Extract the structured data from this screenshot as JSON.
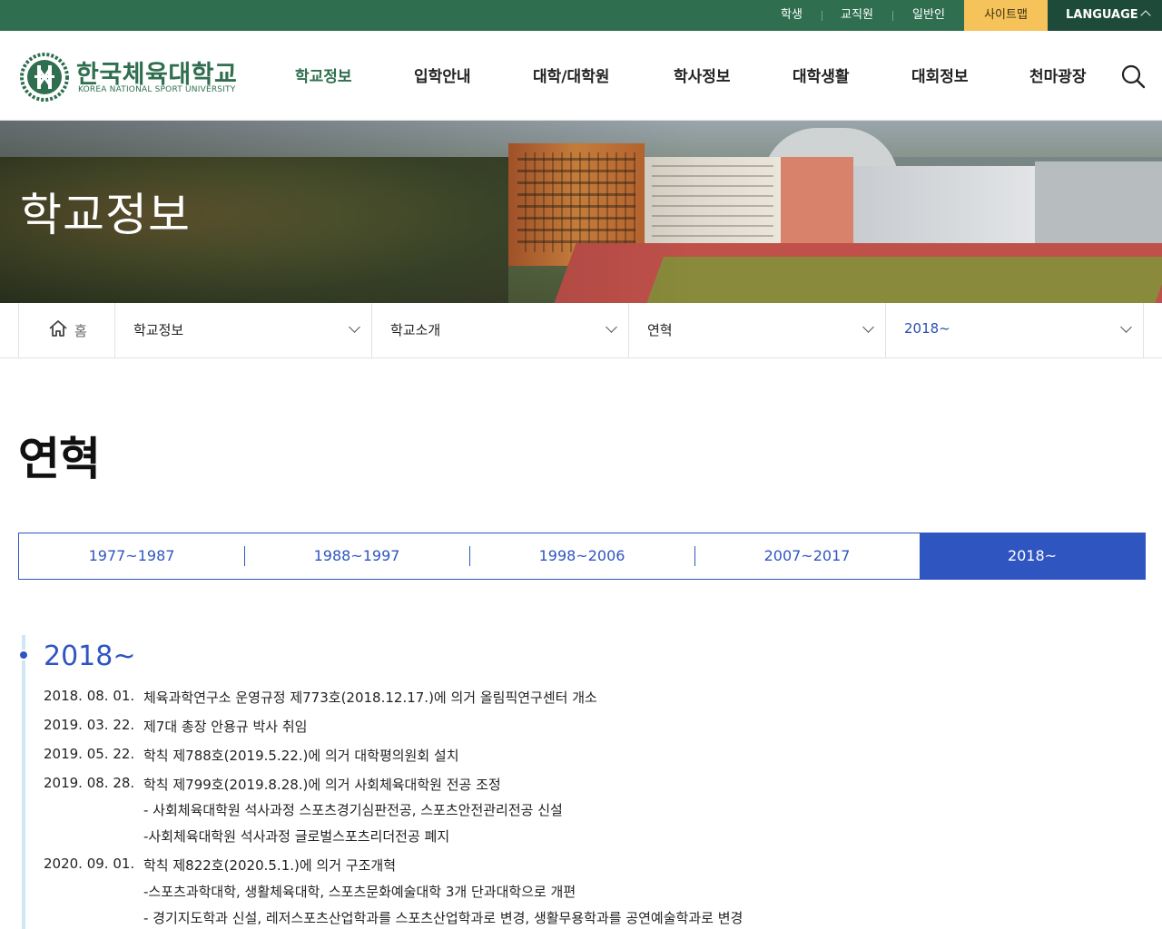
{
  "topbar": {
    "links": [
      "학생",
      "교직원",
      "일반인"
    ],
    "sitemap": "사이트맵",
    "language": "LANGUAGE",
    "colors": {
      "bar": "#2f6f4f",
      "sitemap": "#f6c35b",
      "language": "#1e4a3a"
    }
  },
  "header": {
    "logo_ko": "한국체육대학교",
    "logo_en": "KOREA NATIONAL SPORT UNIVERSITY",
    "nav": [
      "학교정보",
      "입학안내",
      "대학/대학원",
      "학사정보",
      "대학생활",
      "대회정보",
      "천마광장"
    ],
    "active_nav": "학교정보",
    "search_icon": "search-icon"
  },
  "hero": {
    "title": "학교정보"
  },
  "location": {
    "home": "홈",
    "selects": [
      "학교정보",
      "학교소개",
      "연혁",
      "2018~"
    ]
  },
  "page": {
    "title": "연혁"
  },
  "tabs": {
    "items": [
      "1977~1987",
      "1988~1997",
      "1998~2006",
      "2007~2017",
      "2018~"
    ],
    "active": "2018~",
    "accent": "#2f55c0"
  },
  "timeline": {
    "year": "2018~",
    "entries": [
      {
        "date": "2018. 08. 01.",
        "text": "체육과학연구소 운영규정 제773호(2018.12.17.)에 의거 올림픽연구센터 개소",
        "subs": []
      },
      {
        "date": "2019. 03. 22.",
        "text": "제7대 총장 안용규 박사 취임",
        "subs": []
      },
      {
        "date": "2019. 05. 22.",
        "text": "학칙 제788호(2019.5.22.)에 의거 대학평의원회 설치",
        "subs": []
      },
      {
        "date": "2019. 08. 28.",
        "text": "학칙 제799호(2019.8.28.)에 의거 사회체육대학원 전공 조정",
        "subs": [
          "- 사회체육대학원 석사과정 스포츠경기심판전공, 스포츠안전관리전공 신설",
          "-사회체육대학원 석사과정 글로벌스포츠리더전공 폐지"
        ]
      },
      {
        "date": "2020. 09. 01.",
        "text": "학칙 제822호(2020.5.1.)에 의거 구조개혁",
        "subs": [
          "-스포츠과학대학, 생활체육대학, 스포츠문화예술대학 3개 단과대학으로 개편",
          "- 경기지도학과 신설, 레저스포츠산업학과를 스포츠산업학과로 변경, 생활무용학과를 공연예술학과로 변경"
        ]
      }
    ]
  }
}
